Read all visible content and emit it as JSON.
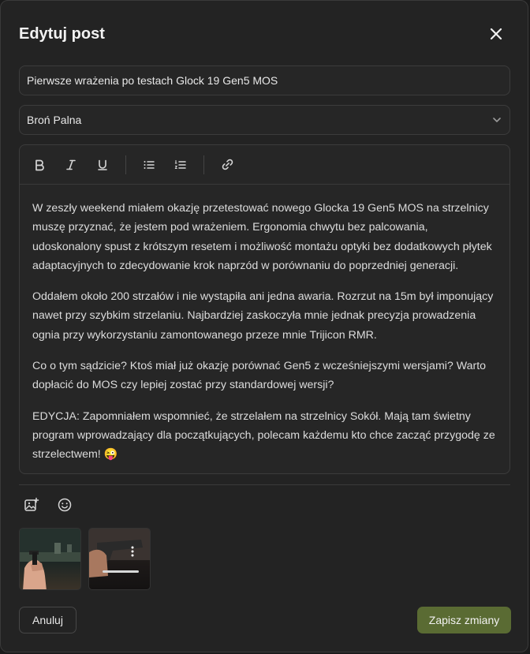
{
  "modal": {
    "title": "Edytuj post",
    "close_icon": "close-icon"
  },
  "form": {
    "title_value": "Pierwsze wrażenia po testach Glock 19 Gen5 MOS",
    "category_value": "Broń Palna"
  },
  "toolbar": {
    "items": [
      "bold-icon",
      "italic-icon",
      "underline-icon",
      "bullet-list-icon",
      "numbered-list-icon",
      "link-icon"
    ]
  },
  "content": {
    "paragraphs": [
      "W zeszły weekend miałem okazję przetestować nowego Glocka 19 Gen5 MOS na strzelnicy muszę przyznać, że jestem pod wrażeniem. Ergonomia chwytu bez palcowania, udoskonalony spust z krótszym resetem i możliwość montażu optyki bez dodatkowych płytek adaptacyjnych to zdecydowanie krok naprzód w porównaniu do poprzedniej generacji.",
      "Oddałem około 200 strzałów i nie wystąpiła ani jedna awaria. Rozrzut na 15m był imponujący nawet przy szybkim strzelaniu. Najbardziej zaskoczyła mnie jednak precyzja prowadzenia ognia przy wykorzystaniu zamontowanego przeze mnie Trijicon RMR.",
      "Co o tym sądzicie? Ktoś miał już okazję porównać Gen5 z wcześniejszymi wersjami? Warto dopłacić do MOS czy lepiej zostać przy standardowej wersji?",
      "EDYCJA: Zapomniałem wspomnieć, że strzelałem na strzelnicy Sokół. Mają tam świetny program wprowadzający dla początkujących, polecam każdemu kto chce zacząć przygodę ze strzelectwem! 😜"
    ]
  },
  "media": {
    "tools": [
      "add-image-icon",
      "emoji-icon"
    ],
    "thumbnails": [
      "photo-1",
      "photo-2"
    ]
  },
  "footer": {
    "cancel_label": "Anuluj",
    "save_label": "Zapisz zmiany"
  },
  "colors": {
    "accent": "#5a6b33",
    "background": "#232323"
  }
}
